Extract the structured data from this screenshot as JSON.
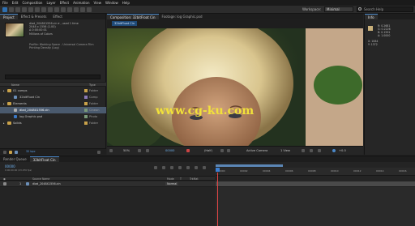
{
  "menu": [
    "File",
    "Edit",
    "Composition",
    "Layer",
    "Effect",
    "Animation",
    "View",
    "Window",
    "Help"
  ],
  "workspace": {
    "label": "Workspace:",
    "value": "Minimal",
    "search_placeholder": "Search Help"
  },
  "project_panel": {
    "tabs": [
      "Project",
      "Effect & Presets",
      "Effect"
    ],
    "item_name": "dlad_2048X1556.cin",
    "item_used": "▾ , used 1 time",
    "item_size": "2048 x 1556 (1.00)",
    "item_duration": "Δ 0:00:00:01",
    "item_colors": "Millions of Colors",
    "item_profile": "Profile: Working Space - Universal Camera Film Printing Density (Log)",
    "search_placeholder": "",
    "col_name": "Name",
    "col_type": "Type",
    "items": [
      {
        "name": "01 comps",
        "type": "Folder",
        "indent": 0,
        "kind": "folder",
        "selected": false
      },
      {
        "name": "32bitFloat Cin",
        "type": "Comp",
        "indent": 1,
        "kind": "comp",
        "selected": false
      },
      {
        "name": "Elements",
        "type": "Folder",
        "indent": 0,
        "kind": "folder",
        "selected": false
      },
      {
        "name": "dlad_2048X1556.cin",
        "type": "Cineon",
        "indent": 1,
        "kind": "footage",
        "selected": true
      },
      {
        "name": "log Graphic.psd",
        "type": "Photo",
        "indent": 1,
        "kind": "psd",
        "selected": false
      },
      {
        "name": "Solids",
        "type": "Folder",
        "indent": 0,
        "kind": "folder",
        "selected": false
      }
    ],
    "footer_bpc": "32 bpc"
  },
  "comp_panel": {
    "tabs": [
      "Composition: 32bitFloat Cin",
      "Footage: log Graphic.psd"
    ],
    "breadcrumb": "32bitFloat Cin",
    "watermark": "www.cg-ku.com",
    "zoom": "50%",
    "timecode": "00000",
    "resolution": "(Half)",
    "camera": "Active Camera",
    "views": "1 View",
    "exposure": "+0.0"
  },
  "info_panel": {
    "tab": "Info",
    "values": [
      "R: 0.2681",
      "G: 0.2226",
      "B: 0.1591",
      "A: 1.0000"
    ],
    "xy": [
      "X: 1084",
      "Y: 1372"
    ]
  },
  "timeline": {
    "tabs": [
      "Render Queue",
      "32bitFloat Cin"
    ],
    "timecode": "00000",
    "timecode_sub": "0:00:00:00 (23.976 fps)",
    "columns": {
      "source_name": "Source Name",
      "mode": "Mode",
      "t": "T",
      "trkmat": "TrkMat"
    },
    "layer": {
      "index": "1",
      "name": "dlad_2048X1556.cin",
      "mode": "Normal"
    },
    "ruler": [
      "00000",
      "00002",
      "00004",
      "00006",
      "00008",
      "00010",
      "00012",
      "00014",
      "00016"
    ]
  },
  "colors": {
    "accent": "#2e6fb0",
    "timecode": "#6fb3f0",
    "cti": "#dd4444",
    "selected_row": "#4a5a6e"
  }
}
